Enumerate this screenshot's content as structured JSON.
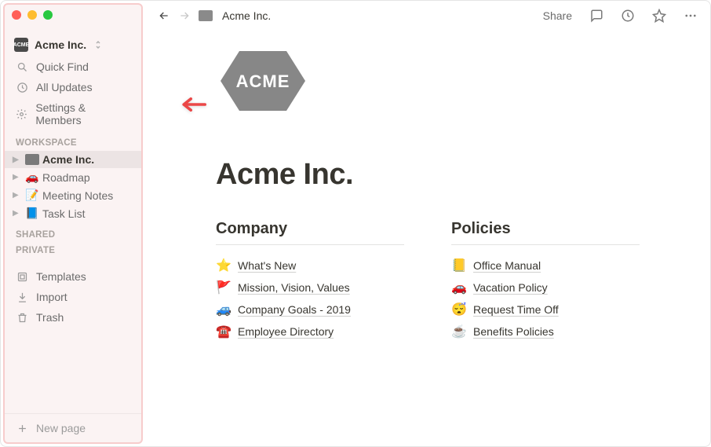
{
  "workspace": {
    "name": "Acme Inc."
  },
  "sidebar": {
    "quick_find": "Quick Find",
    "all_updates": "All Updates",
    "settings": "Settings & Members",
    "section_workspace": "WORKSPACE",
    "section_shared": "SHARED",
    "section_private": "PRIVATE",
    "pages": [
      {
        "emoji": "badge",
        "label": "Acme Inc."
      },
      {
        "emoji": "🚗",
        "label": "Roadmap"
      },
      {
        "emoji": "📝",
        "label": "Meeting Notes"
      },
      {
        "emoji": "📘",
        "label": "Task List"
      }
    ],
    "templates": "Templates",
    "import": "Import",
    "trash": "Trash",
    "new_page": "New page"
  },
  "topbar": {
    "breadcrumb": "Acme Inc.",
    "share": "Share"
  },
  "page": {
    "title": "Acme Inc.",
    "logo_text": "ACME",
    "columns": [
      {
        "heading": "Company",
        "links": [
          {
            "emoji": "⭐",
            "text": "What's New"
          },
          {
            "emoji": "🚩",
            "text": "Mission, Vision, Values"
          },
          {
            "emoji": "🚙",
            "text": "Company Goals - 2019"
          },
          {
            "emoji": "☎️",
            "text": "Employee Directory"
          }
        ]
      },
      {
        "heading": "Policies",
        "links": [
          {
            "emoji": "📒",
            "text": "Office Manual"
          },
          {
            "emoji": "🚗",
            "text": "Vacation Policy"
          },
          {
            "emoji": "😴",
            "text": "Request Time Off"
          },
          {
            "emoji": "☕",
            "text": "Benefits Policies"
          }
        ]
      }
    ]
  }
}
